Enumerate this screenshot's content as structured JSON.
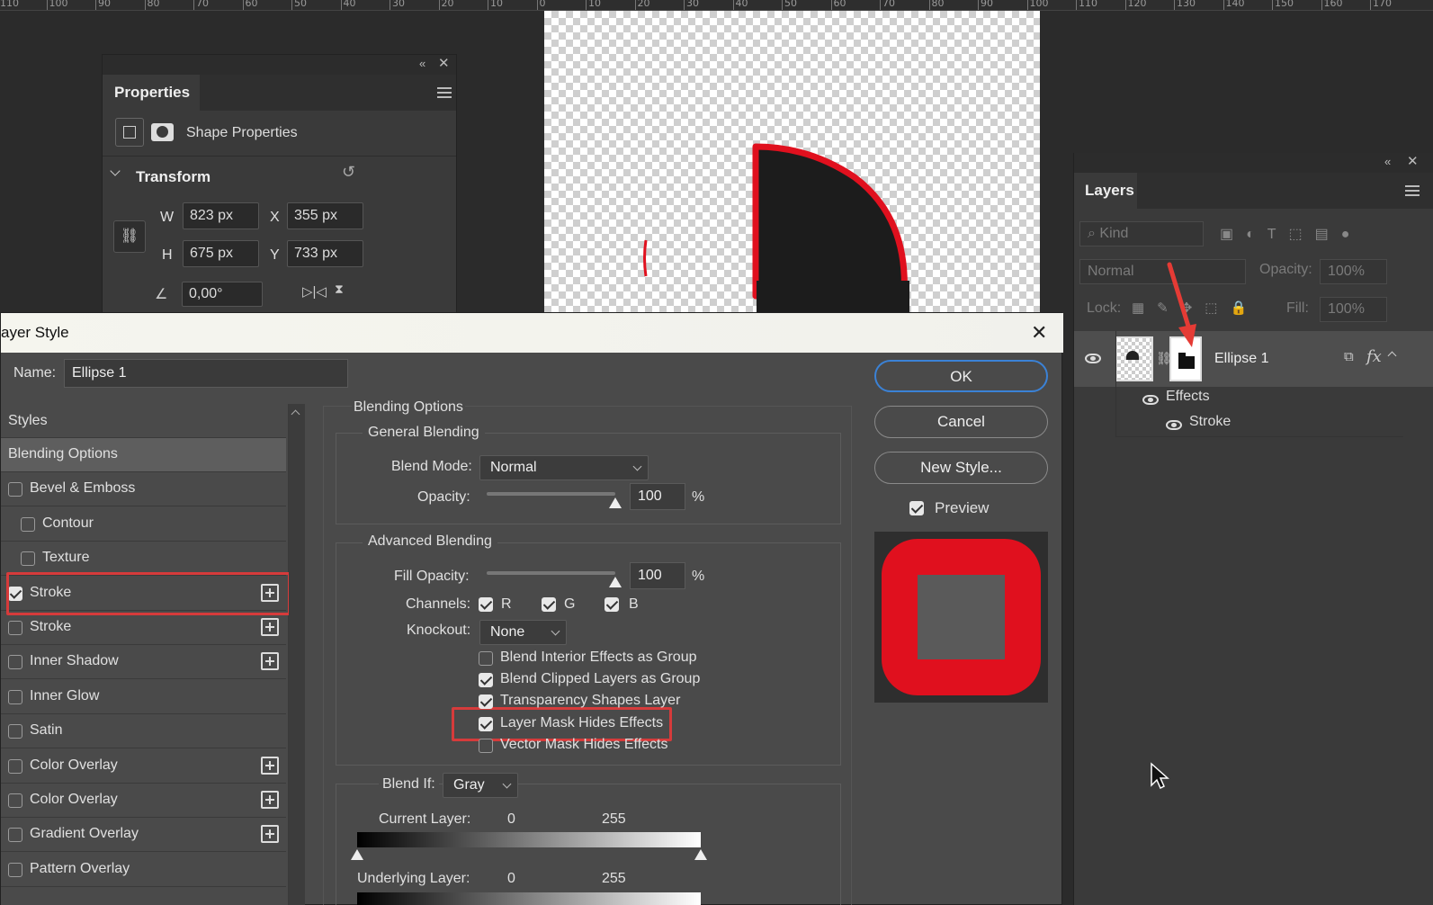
{
  "ruler": {
    "labels": [
      "110",
      "100",
      "90",
      "80",
      "70",
      "60",
      "50",
      "40",
      "30",
      "20",
      "10",
      "0",
      "10",
      "20",
      "30",
      "40",
      "50",
      "60",
      "70",
      "80",
      "90",
      "100",
      "110",
      "120",
      "130",
      "140",
      "150",
      "160",
      "170"
    ]
  },
  "properties": {
    "tab": "Properties",
    "shape_label": "Shape Properties",
    "section": "Transform",
    "w_label": "W",
    "w_value": "823 px",
    "h_label": "H",
    "h_value": "675 px",
    "x_label": "X",
    "x_value": "355 px",
    "y_label": "Y",
    "y_value": "733 px",
    "angle_value": "0,00°"
  },
  "layers": {
    "tab": "Layers",
    "kind_placeholder": "Kind",
    "blend_mode": "Normal",
    "opacity_label": "Opacity:",
    "opacity_value": "100%",
    "lock_label": "Lock:",
    "fill_label": "Fill:",
    "fill_value": "100%",
    "layer_name": "Ellipse 1",
    "effects_label": "Effects",
    "stroke_label": "Stroke",
    "fx_label": "fx"
  },
  "dialog": {
    "title": "ayer Style",
    "name_label": "Name:",
    "name_value": "Ellipse 1",
    "styles_header": "Styles",
    "styles": [
      {
        "label": "Blending Options",
        "checkbox": false,
        "checked": false,
        "plus": false,
        "active": true,
        "indent": false
      },
      {
        "label": "Bevel & Emboss",
        "checkbox": true,
        "checked": false,
        "plus": false,
        "active": false,
        "indent": false
      },
      {
        "label": "Contour",
        "checkbox": true,
        "checked": false,
        "plus": false,
        "active": false,
        "indent": true
      },
      {
        "label": "Texture",
        "checkbox": true,
        "checked": false,
        "plus": false,
        "active": false,
        "indent": true
      },
      {
        "label": "Stroke",
        "checkbox": true,
        "checked": true,
        "plus": true,
        "active": false,
        "indent": false
      },
      {
        "label": "Stroke",
        "checkbox": true,
        "checked": false,
        "plus": true,
        "active": false,
        "indent": false
      },
      {
        "label": "Inner Shadow",
        "checkbox": true,
        "checked": false,
        "plus": true,
        "active": false,
        "indent": false
      },
      {
        "label": "Inner Glow",
        "checkbox": true,
        "checked": false,
        "plus": false,
        "active": false,
        "indent": false
      },
      {
        "label": "Satin",
        "checkbox": true,
        "checked": false,
        "plus": false,
        "active": false,
        "indent": false
      },
      {
        "label": "Color Overlay",
        "checkbox": true,
        "checked": false,
        "plus": true,
        "active": false,
        "indent": false
      },
      {
        "label": "Color Overlay",
        "checkbox": true,
        "checked": false,
        "plus": true,
        "active": false,
        "indent": false
      },
      {
        "label": "Gradient Overlay",
        "checkbox": true,
        "checked": false,
        "plus": true,
        "active": false,
        "indent": false
      },
      {
        "label": "Pattern Overlay",
        "checkbox": true,
        "checked": false,
        "plus": false,
        "active": false,
        "indent": false
      }
    ],
    "blending": {
      "title": "Blending Options",
      "general": "General Blending",
      "blend_mode_label": "Blend Mode:",
      "blend_mode": "Normal",
      "opacity_label": "Opacity:",
      "opacity": "100",
      "opacity_level": 1.0,
      "pct": "%",
      "advanced": "Advanced Blending",
      "fill_opacity_label": "Fill Opacity:",
      "fill_opacity": "100",
      "fill_opacity_level": 1.0,
      "channels_label": "Channels:",
      "channel_r": "R",
      "channel_g": "G",
      "channel_b": "B",
      "knockout_label": "Knockout:",
      "knockout": "None",
      "options": [
        {
          "label": "Blend Interior Effects as Group",
          "checked": false
        },
        {
          "label": "Blend Clipped Layers as Group",
          "checked": true
        },
        {
          "label": "Transparency Shapes Layer",
          "checked": true
        },
        {
          "label": "Layer Mask Hides Effects",
          "checked": true
        },
        {
          "label": "Vector Mask Hides Effects",
          "checked": false
        }
      ],
      "blend_if_label": "Blend If:",
      "blend_if": "Gray",
      "current_layer_label": "Current Layer:",
      "underlying_layer_label": "Underlying Layer:",
      "range_min": "0",
      "range_max": "255"
    },
    "buttons": {
      "ok": "OK",
      "cancel": "Cancel",
      "new_style": "New Style..."
    },
    "preview_label": "Preview"
  },
  "colors": {
    "accent_red": "#e0101e",
    "highlight": "#d63b3b",
    "ok_border": "#3b82d6"
  }
}
